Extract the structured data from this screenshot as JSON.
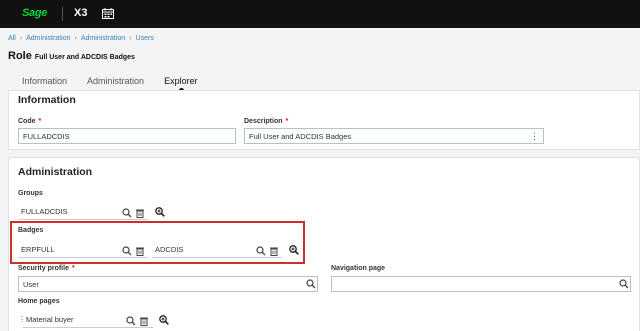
{
  "header": {
    "logo": "Sage",
    "product": "X3",
    "calendar_icon": "calendar-icon"
  },
  "breadcrumb": [
    "All",
    "Administration",
    "Administration",
    "Users"
  ],
  "page": {
    "title": "Role",
    "subtitle": "Full User and ADCDIS Badges"
  },
  "tabs": [
    {
      "label": "Information",
      "active": false
    },
    {
      "label": "Administration",
      "active": false
    },
    {
      "label": "Explorer",
      "active": true
    }
  ],
  "information": {
    "title": "Information",
    "code_label": "Code",
    "code_value": "FULLADCDIS",
    "description_label": "Description",
    "description_value": "Full User and ADCDIS Badges"
  },
  "administration": {
    "title": "Administration",
    "groups_label": "Groups",
    "groups_value": "FULLADCDIS",
    "badges_label": "Badges",
    "badges": [
      "ERPFULL",
      "ADCDIS"
    ],
    "security_profile_label": "Security profile",
    "security_profile_value": "User",
    "navigation_page_label": "Navigation page",
    "navigation_page_value": "",
    "home_pages_label": "Home pages",
    "home_pages_value": "Material buyer"
  },
  "colors": {
    "accent": "#00d639",
    "link": "#3a7fb5",
    "required": "#d11111",
    "highlight": "#c9302c"
  }
}
